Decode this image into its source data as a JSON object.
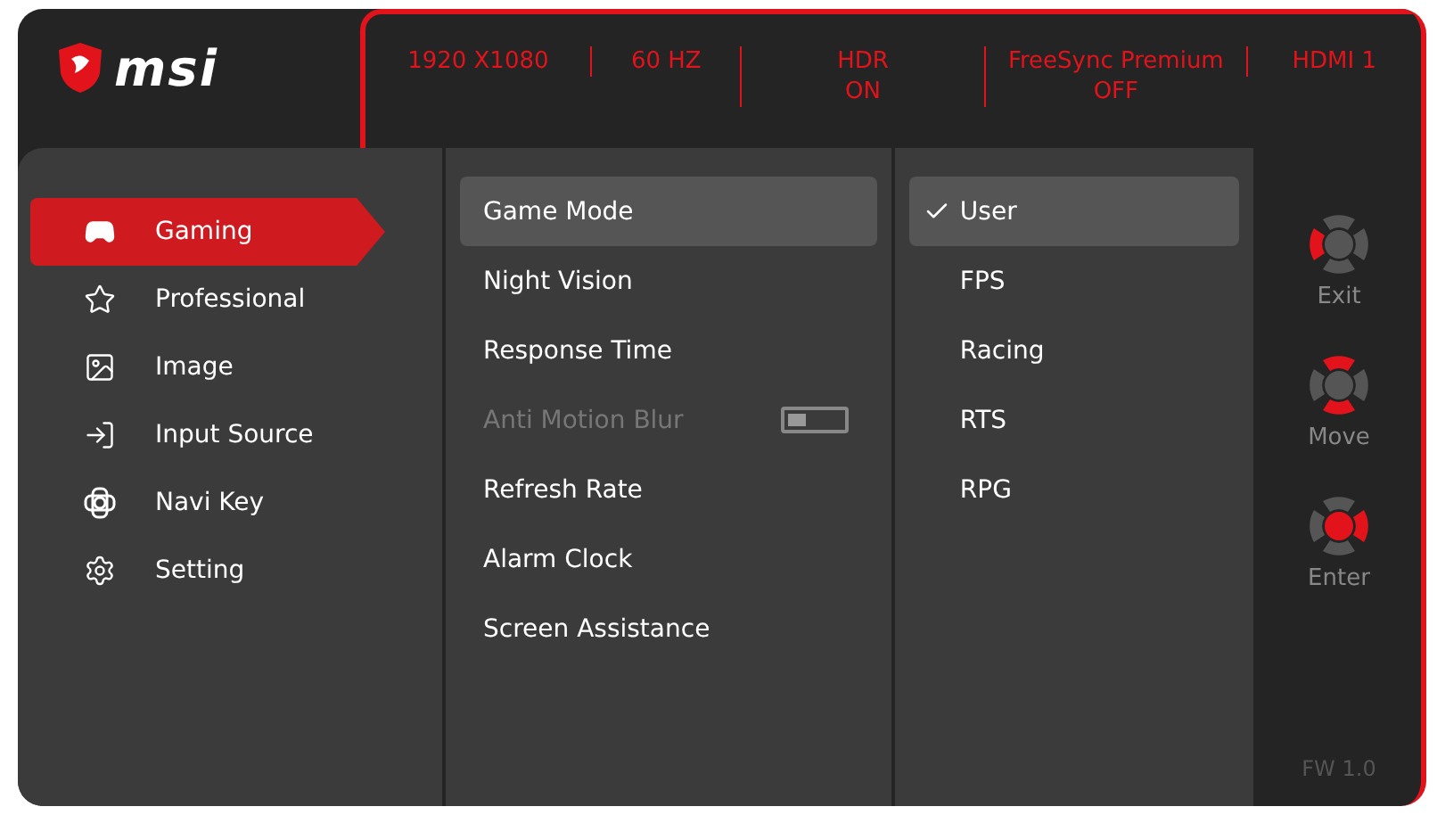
{
  "logo": {
    "text": "msi"
  },
  "status": [
    {
      "lines": [
        "1920 X1080"
      ]
    },
    {
      "lines": [
        "60 HZ"
      ]
    },
    {
      "lines": [
        "HDR",
        "ON"
      ]
    },
    {
      "lines": [
        "FreeSync Premium",
        "OFF"
      ]
    },
    {
      "lines": [
        "HDMI 1"
      ]
    }
  ],
  "sidebar": {
    "items": [
      {
        "label": "Gaming",
        "selected": true
      },
      {
        "label": "Professional",
        "selected": false
      },
      {
        "label": "Image",
        "selected": false
      },
      {
        "label": "Input Source",
        "selected": false
      },
      {
        "label": "Navi Key",
        "selected": false
      },
      {
        "label": "Setting",
        "selected": false
      }
    ]
  },
  "submenu": {
    "items": [
      {
        "label": "Game Mode",
        "selected": true,
        "disabled": false
      },
      {
        "label": "Night Vision",
        "selected": false,
        "disabled": false
      },
      {
        "label": "Response Time",
        "selected": false,
        "disabled": false
      },
      {
        "label": "Anti Motion Blur",
        "selected": false,
        "disabled": true,
        "kind": "toggle",
        "on": false
      },
      {
        "label": "Refresh Rate",
        "selected": false,
        "disabled": false
      },
      {
        "label": "Alarm Clock",
        "selected": false,
        "disabled": false
      },
      {
        "label": "Screen Assistance",
        "selected": false,
        "disabled": false
      }
    ]
  },
  "options": {
    "items": [
      {
        "label": "User",
        "selected": true
      },
      {
        "label": "FPS",
        "selected": false
      },
      {
        "label": "Racing",
        "selected": false
      },
      {
        "label": "RTS",
        "selected": false
      },
      {
        "label": "RPG",
        "selected": false
      }
    ]
  },
  "navi_hints": [
    {
      "label": "Exit",
      "up": false,
      "down": false,
      "left": true,
      "right": false,
      "ok": false
    },
    {
      "label": "Move",
      "up": true,
      "down": true,
      "left": false,
      "right": false,
      "ok": false
    },
    {
      "label": "Enter",
      "up": false,
      "down": false,
      "left": false,
      "right": true,
      "ok": true
    }
  ],
  "firmware": "FW 1.0"
}
